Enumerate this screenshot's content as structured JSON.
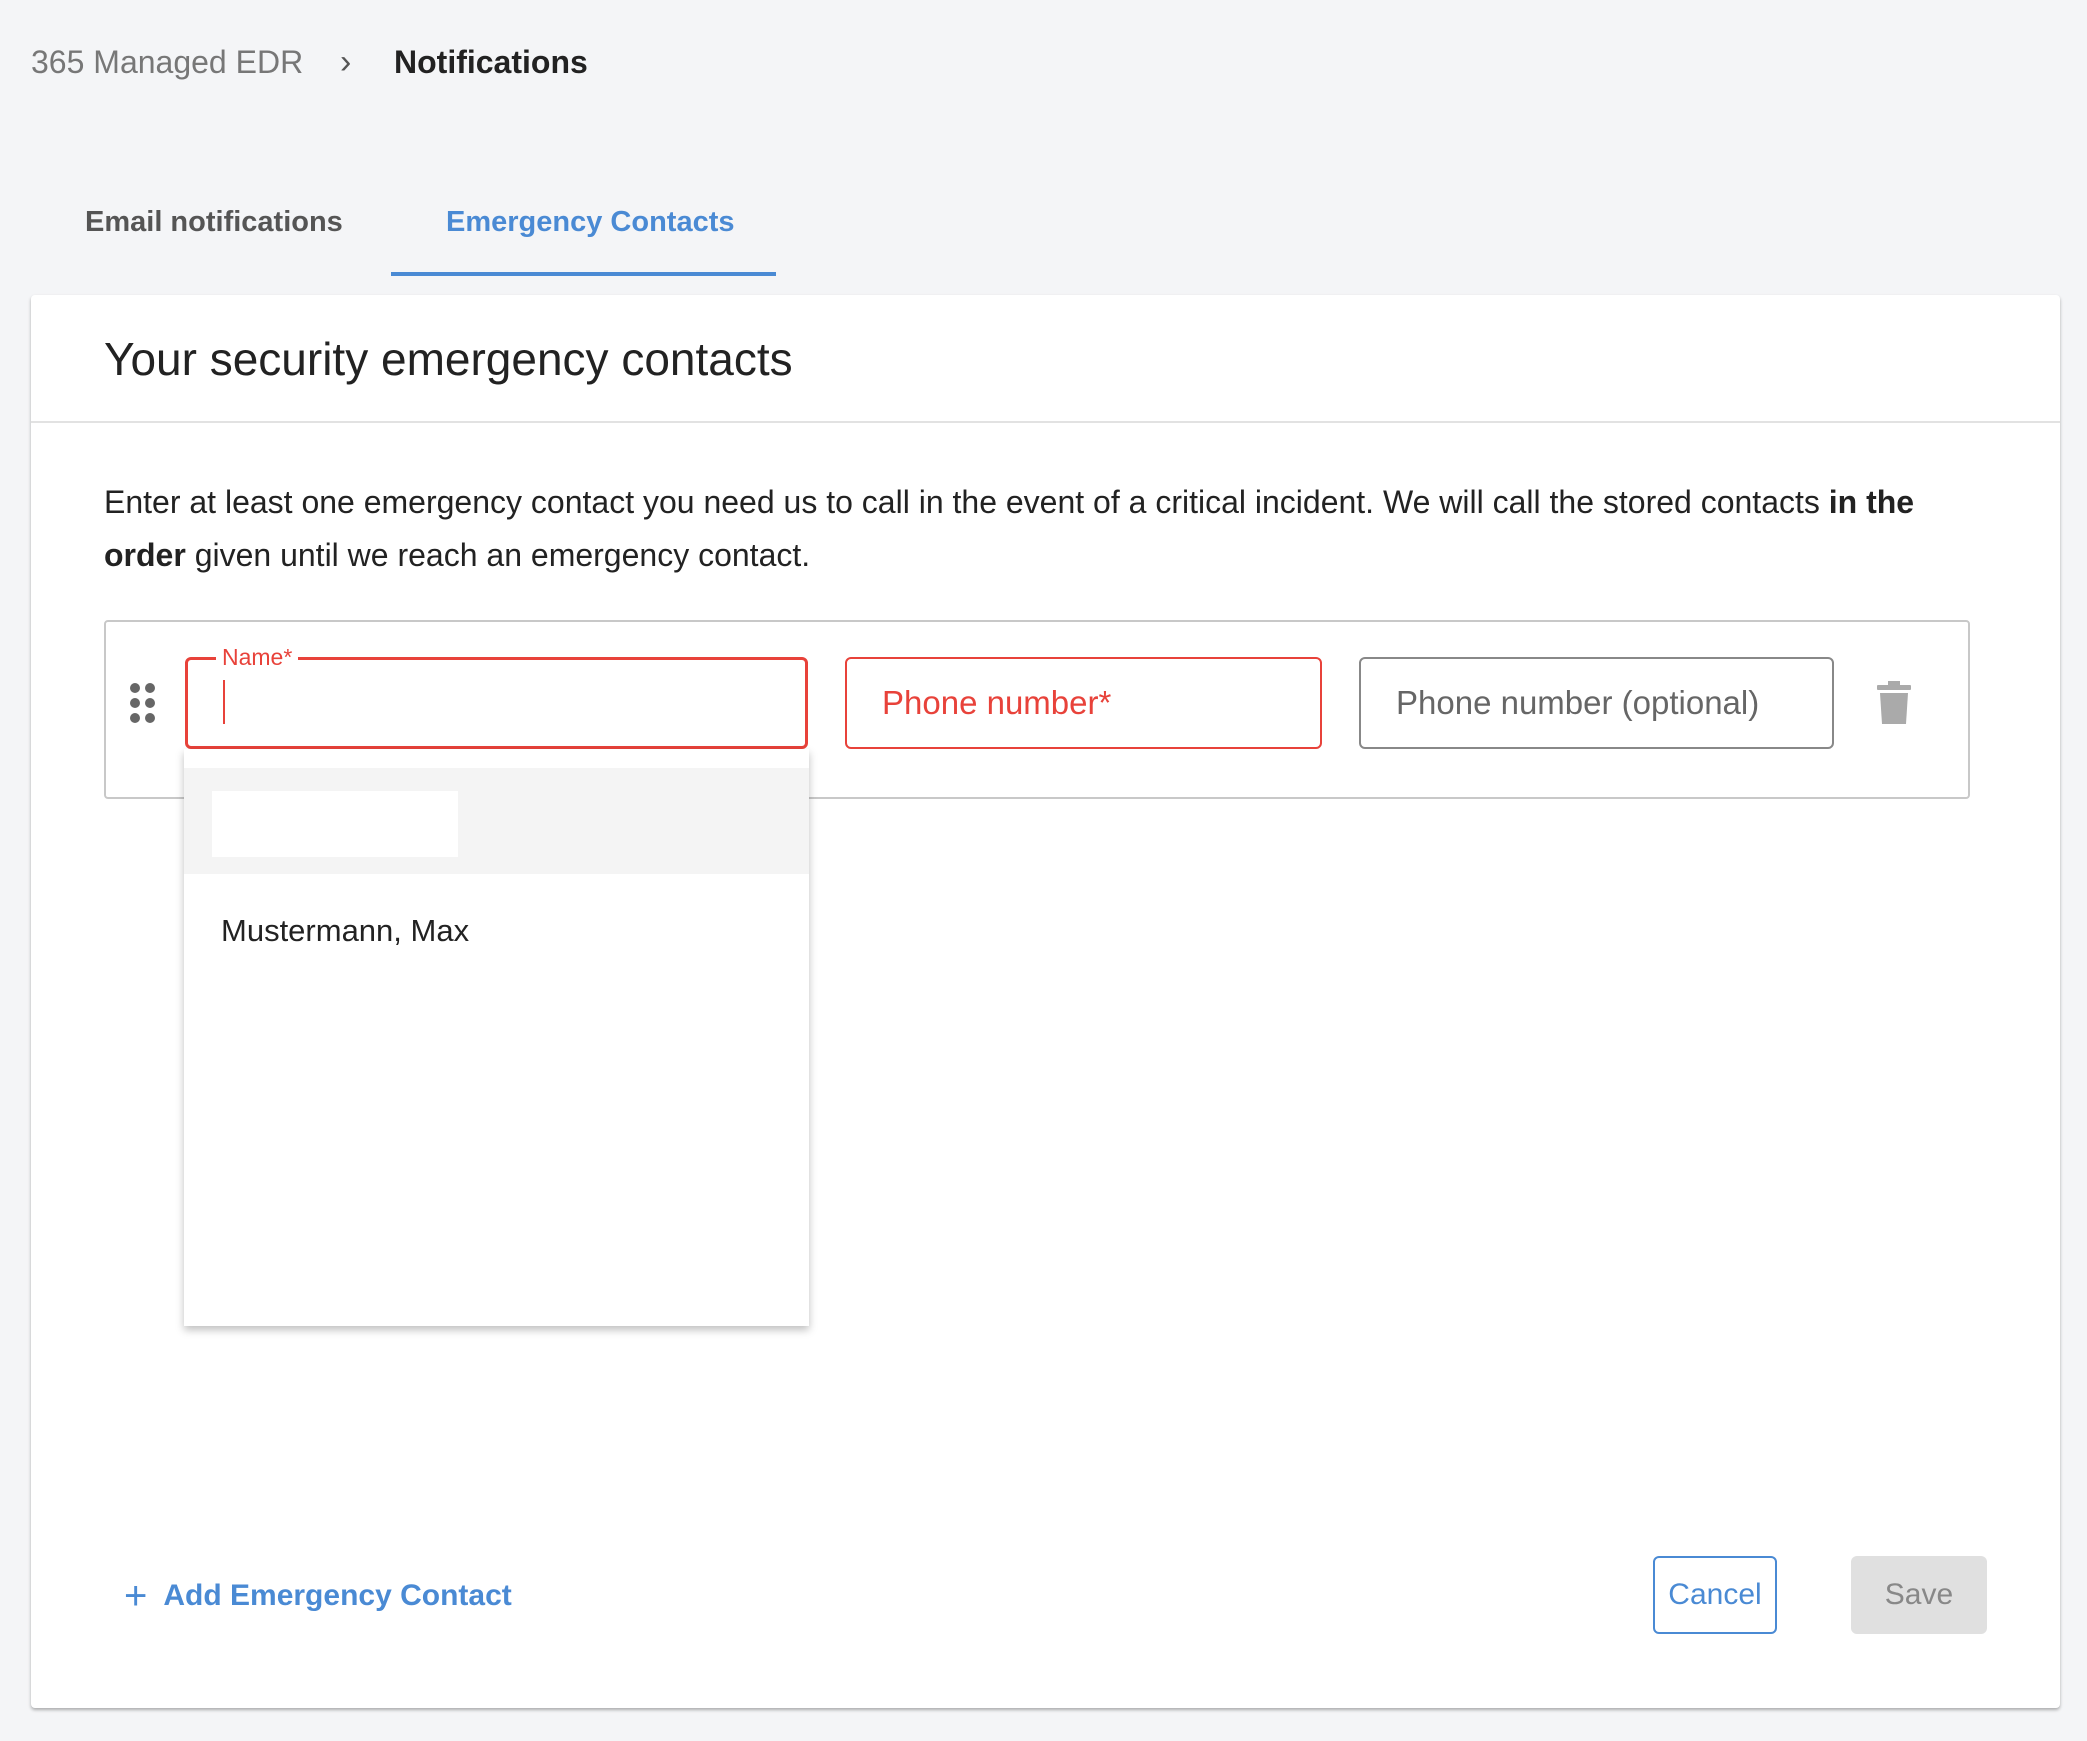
{
  "breadcrumb": {
    "parent": "365 Managed EDR",
    "separator": "›",
    "current": "Notifications"
  },
  "tabs": [
    {
      "label": "Email notifications",
      "active": false
    },
    {
      "label": "Emergency Contacts",
      "active": true
    }
  ],
  "card": {
    "title": "Your security emergency contacts",
    "description_pre": "Enter at least one emergency contact you need us to call in the event of a critical incident. We will call the stored contacts ",
    "description_bold": "in the order",
    "description_post": " given until we reach an emergency contact."
  },
  "contact_row": {
    "name_label": "Name*",
    "name_value": "",
    "phone_placeholder": "Phone number*",
    "phone_optional_placeholder": "Phone number (optional)",
    "icons": {
      "drag": "drag-handle-icon",
      "delete": "trash-icon"
    }
  },
  "dropdown": {
    "options": [
      "Mustermann, Max"
    ]
  },
  "actions": {
    "add_label": "Add Emergency Contact",
    "add_icon": "+",
    "cancel": "Cancel",
    "save": "Save",
    "save_disabled": true
  },
  "colors": {
    "accent": "#4a8ad4",
    "error": "#e8423a",
    "disabled": "#e0e0e0"
  }
}
